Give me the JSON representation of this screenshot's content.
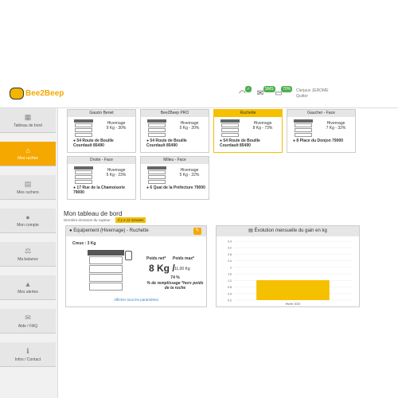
{
  "brand": {
    "name": "Bee2Beep"
  },
  "user": {
    "name": "Clerjaux JEROME",
    "sub": "Quitter"
  },
  "topbar": {
    "sms_badge": "SMS",
    "battery_pct": "70%"
  },
  "sidebar": {
    "items": [
      {
        "label": "Tableau de bord",
        "icon": "dashboard-icon"
      },
      {
        "label": "Mes ruches",
        "icon": "home-icon"
      },
      {
        "label": "Mes ruchers",
        "icon": "apiary-icon"
      },
      {
        "label": "Mon compte",
        "icon": "user-icon"
      },
      {
        "label": "Ma balance",
        "icon": "scale-icon"
      },
      {
        "label": "Mes alertes",
        "icon": "bell-icon"
      },
      {
        "label": "Aide / FAQ",
        "icon": "help-icon"
      },
      {
        "label": "Infos / Contact",
        "icon": "info-icon"
      }
    ]
  },
  "hives": [
    {
      "title": "Gaucin Benet",
      "mode": "Hivernage",
      "value": "9 Kg - 30%",
      "address": "54 Route de Bouille Courdault 85490"
    },
    {
      "title": "Bee2Beep PRO",
      "mode": "Hivernage",
      "value": "5 Kg - 20%",
      "address": "54 Route de Bouille Courdault 85490"
    },
    {
      "title": "Ruchette",
      "mode": "Hivernage",
      "value": "8 Kg - 73%",
      "address": "54 Route de Bouille Courdault 85490"
    },
    {
      "title": "Gaucher - Face",
      "mode": "Hivernage",
      "value": "7 Kg - 32%",
      "address": "8 Place du Donjon 79000"
    },
    {
      "title": "Droite - Face",
      "mode": "Hivernage",
      "value": "5 Kg - 23%",
      "address": "17 Rue de la Chamoiserie 79000"
    },
    {
      "title": "Milieu - Face",
      "mode": "Hivernage",
      "value": "5 Kg - 22%",
      "address": "6 Quai de la Préfecture 79000"
    }
  ],
  "dashboard": {
    "title": "Mon tableau de bord",
    "subtitle": "Dernière émission du capteur :",
    "badge": "il y a 11 minutes"
  },
  "equipment": {
    "header": "Equipement (Hivernage) - Ruchette",
    "creux": "Creux : 3 Kg",
    "poids_net_label": "Poids net*",
    "poids_max_label": "Poids max*",
    "poids_net_value": "8 Kg /",
    "poids_max_value": "11,00 Kg",
    "fill_pct": "74 %",
    "fill_text": "% de remplissage *hors poids de la ruche",
    "settings_link": "Afficher tous les paramètres"
  },
  "chart_data": {
    "type": "bar",
    "title": "Évolution mensuelle du gain en kg",
    "categories": [
      "février 2023"
    ],
    "values": [
      1.35
    ],
    "ylim": [
      0.2,
      3.6
    ],
    "yticks": [
      "3.4",
      "3.2",
      "2.8",
      "2.4",
      "2",
      "1.6",
      "1.2",
      "0.8",
      "0.4",
      "0.2"
    ],
    "bar_color": "#f5c000"
  }
}
